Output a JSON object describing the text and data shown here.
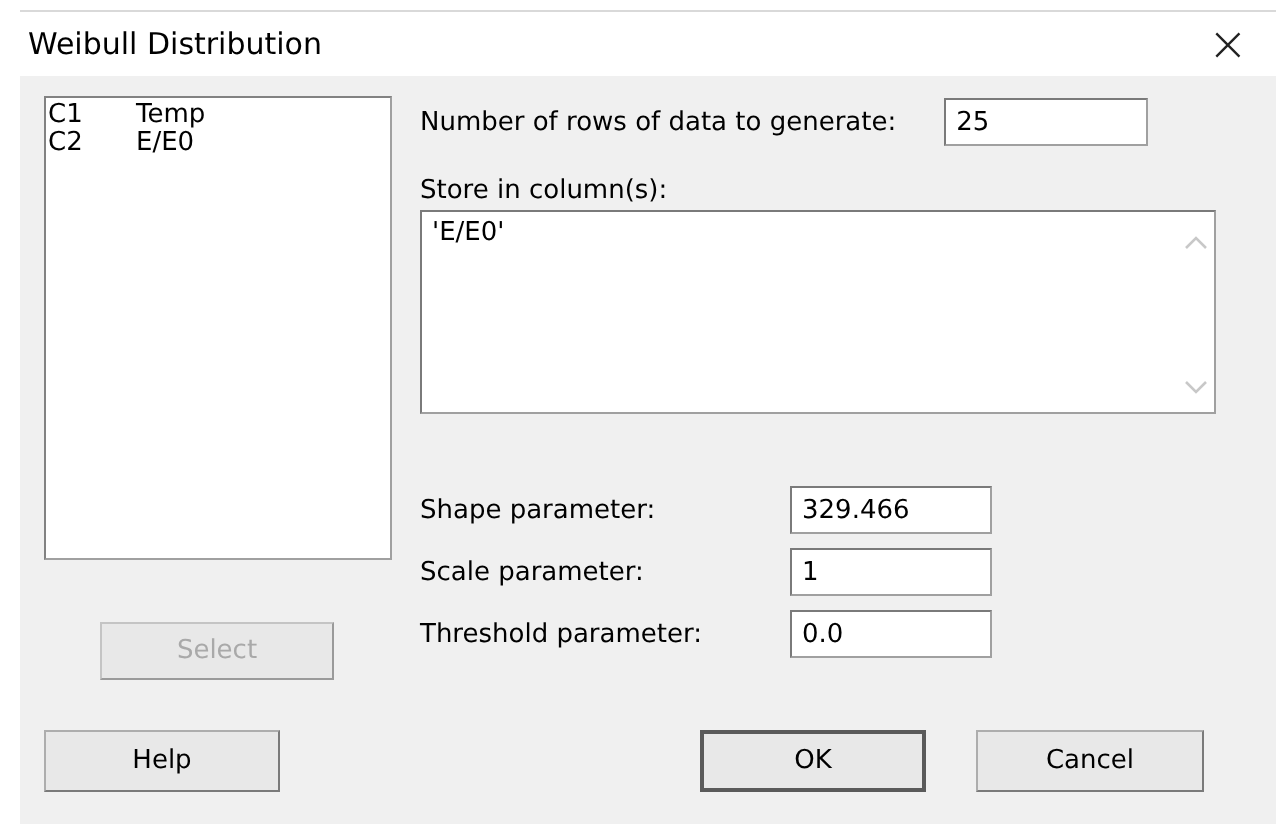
{
  "window": {
    "title": "Weibull Distribution",
    "close": "×"
  },
  "columns_list": [
    {
      "id": "C1",
      "name": "Temp"
    },
    {
      "id": "C2",
      "name": "E/E0"
    }
  ],
  "select_button": {
    "label": "Select",
    "disabled": true
  },
  "rows_to_generate": {
    "label": "Number of rows of data to generate:",
    "value": "25"
  },
  "store_in": {
    "label": "Store in column(s):",
    "value": "'E/E0'"
  },
  "parameters": [
    {
      "label": "Shape parameter:",
      "value": "329.466"
    },
    {
      "label": "Scale parameter:",
      "value": "1"
    },
    {
      "label": "Threshold parameter:",
      "value": "0.0"
    }
  ],
  "buttons": {
    "help": "Help",
    "ok": "OK",
    "cancel": "Cancel"
  }
}
